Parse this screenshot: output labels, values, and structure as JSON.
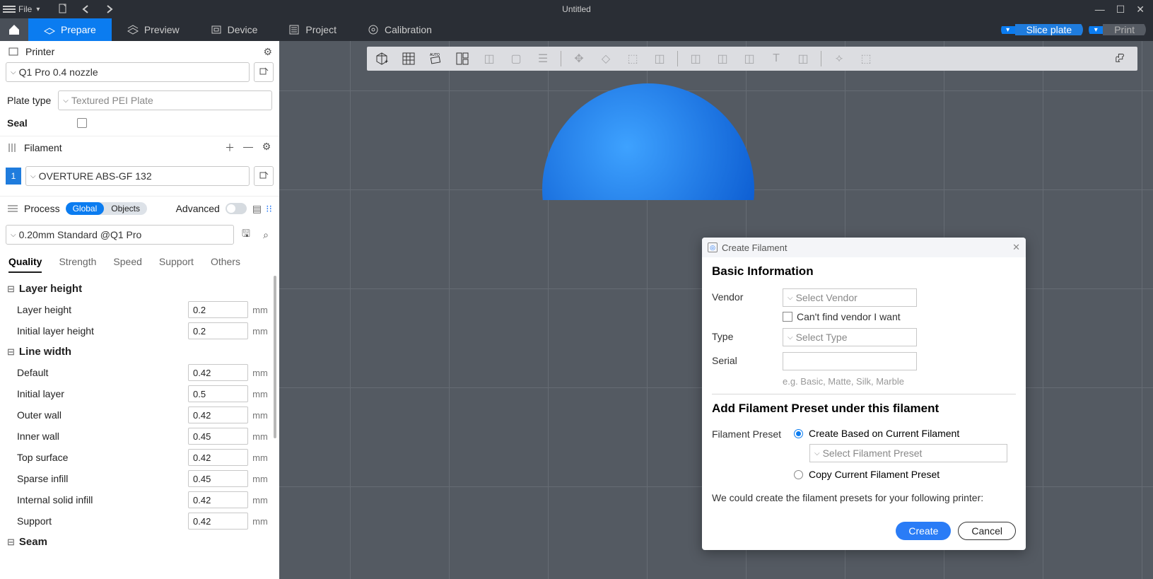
{
  "titlebar": {
    "file_label": "File",
    "doc_title": "Untitled"
  },
  "nav": {
    "prepare": "Prepare",
    "preview": "Preview",
    "device": "Device",
    "project": "Project",
    "calibration": "Calibration",
    "slice_btn": "Slice plate",
    "print_btn": "Print"
  },
  "sidebar": {
    "printer_label": "Printer",
    "printer_value": "Q1 Pro 0.4 nozzle",
    "plate_label": "Plate type",
    "plate_value": "Textured PEI Plate",
    "seal_label": "Seal",
    "filament_label": "Filament",
    "filament_swatch": "1",
    "filament_value": "OVERTURE ABS-GF 132",
    "process_label": "Process",
    "toggle_global": "Global",
    "toggle_objects": "Objects",
    "advanced_label": "Advanced",
    "process_value": "0.20mm Standard @Q1 Pro",
    "tabs": [
      "Quality",
      "Strength",
      "Speed",
      "Support",
      "Others"
    ],
    "group_layer": "Layer height",
    "group_line": "Line width",
    "group_seam": "Seam",
    "params_layer": [
      {
        "label": "Layer height",
        "value": "0.2",
        "unit": "mm"
      },
      {
        "label": "Initial layer height",
        "value": "0.2",
        "unit": "mm"
      }
    ],
    "params_line": [
      {
        "label": "Default",
        "value": "0.42",
        "unit": "mm"
      },
      {
        "label": "Initial layer",
        "value": "0.5",
        "unit": "mm"
      },
      {
        "label": "Outer wall",
        "value": "0.42",
        "unit": "mm"
      },
      {
        "label": "Inner wall",
        "value": "0.45",
        "unit": "mm"
      },
      {
        "label": "Top surface",
        "value": "0.42",
        "unit": "mm"
      },
      {
        "label": "Sparse infill",
        "value": "0.45",
        "unit": "mm"
      },
      {
        "label": "Internal solid infill",
        "value": "0.42",
        "unit": "mm"
      },
      {
        "label": "Support",
        "value": "0.42",
        "unit": "mm"
      }
    ]
  },
  "modal": {
    "title": "Create Filament",
    "basic_info": "Basic Information",
    "vendor_label": "Vendor",
    "vendor_placeholder": "Select Vendor",
    "vendor_cb": "Can't find vendor I want",
    "type_label": "Type",
    "type_placeholder": "Select Type",
    "serial_label": "Serial",
    "serial_hint": "e.g. Basic, Matte, Silk, Marble",
    "add_preset": "Add Filament Preset under this filament",
    "preset_label": "Filament Preset",
    "radio_create": "Create Based on Current Filament",
    "preset_placeholder": "Select Filament Preset",
    "radio_copy": "Copy Current Filament Preset",
    "hint2": "We could create the filament presets for your following printer:",
    "create_btn": "Create",
    "cancel_btn": "Cancel"
  }
}
